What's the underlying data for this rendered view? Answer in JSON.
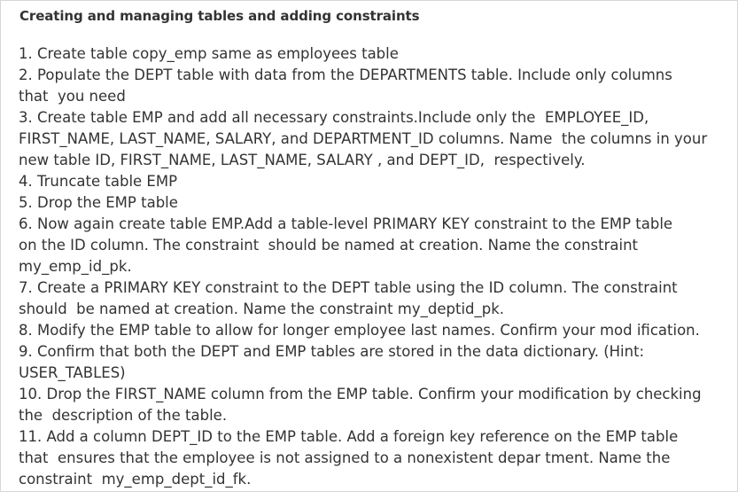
{
  "document": {
    "title": "Creating and managing tables and adding constraints",
    "lines": [
      "1. Create table copy_emp same as employees table",
      "2. Populate the DEPT table with data from the DEPARTMENTS table. Include only columns",
      "that  you need",
      "3. Create table EMP and add all necessary constraints.Include only the  EMPLOYEE_ID,",
      "FIRST_NAME, LAST_NAME, SALARY, and DEPARTMENT_ID columns. Name  the columns in your",
      "new table ID, FIRST_NAME, LAST_NAME, SALARY , and DEPT_ID,  respectively.",
      "4. Truncate table EMP",
      "5. Drop the EMP table",
      "6. Now again create table EMP.Add a table-level PRIMARY KEY constraint to the EMP table",
      "on the ID column. The constraint  should be named at creation. Name the constraint",
      "my_emp_id_pk.",
      "7. Create a PRIMARY KEY constraint to the DEPT table using the ID column. The constraint",
      "should  be named at creation. Name the constraint my_deptid_pk.",
      "8. Modify the EMP table to allow for longer employee last names. Confirm your mod ification.",
      "9. Confirm that both the DEPT and EMP tables are stored in the data dictionary. (Hint:",
      "USER_TABLES)",
      "10. Drop the FIRST_NAME column from the EMP table. Confirm your modification by checking",
      "the  description of the table.",
      "11. Add a column DEPT_ID to the EMP table. Add a foreign key reference on the EMP table",
      "that  ensures that the employee is not assigned to a nonexistent depar tment. Name the",
      "constraint  my_emp_dept_id_fk."
    ]
  }
}
